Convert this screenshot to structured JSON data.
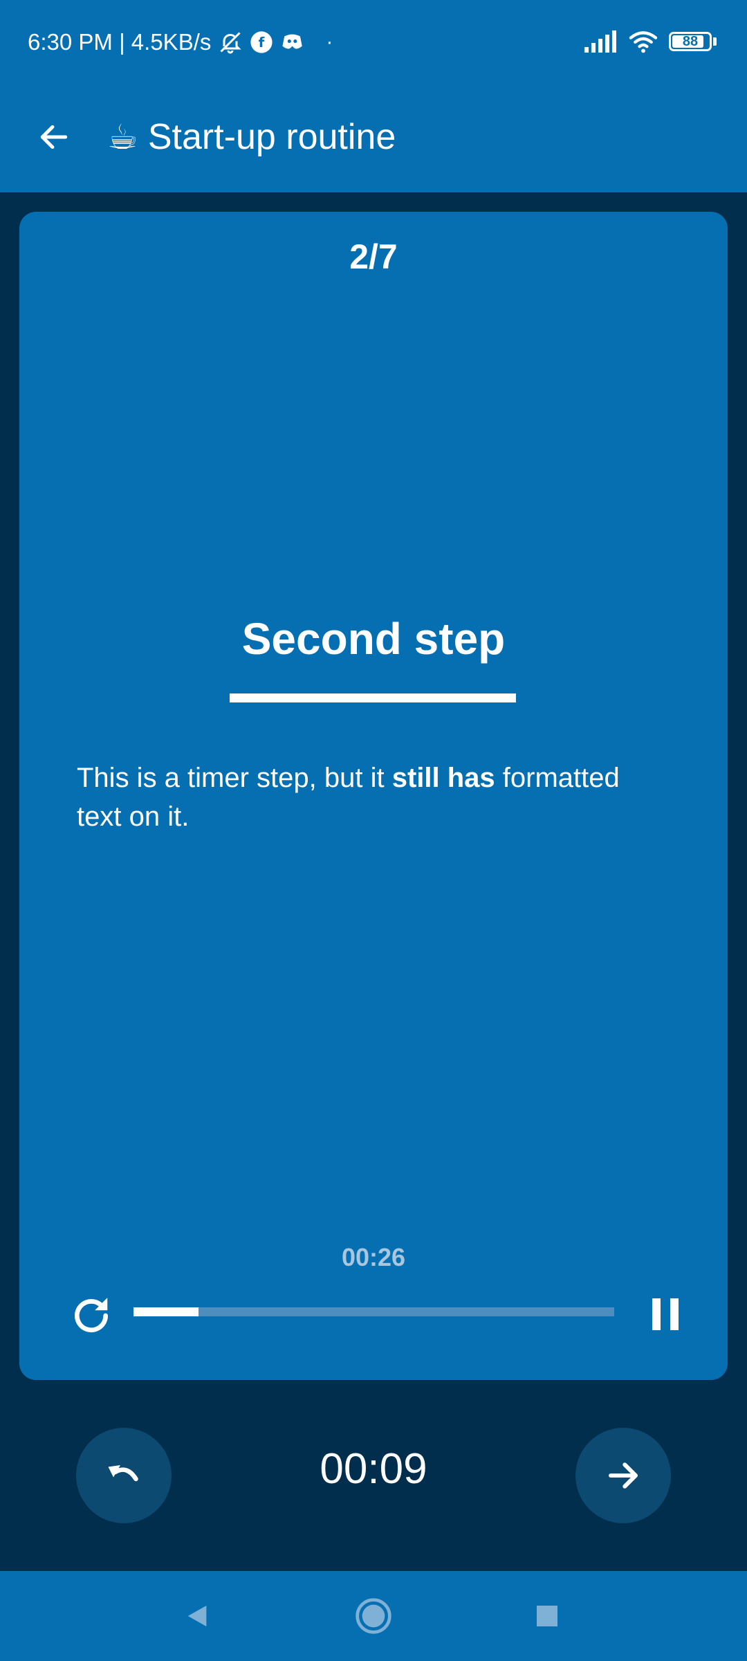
{
  "status_bar": {
    "time_speed": "6:30 PM | 4.5KB/s",
    "dot": "·",
    "battery": "88",
    "battery_level": 0.88,
    "icons": [
      "bell-off-icon",
      "app-icon",
      "discord-icon",
      "signal-icon",
      "wifi-icon",
      "battery-icon"
    ]
  },
  "app_bar": {
    "emoji": "☕",
    "title": "Start-up routine",
    "back_icon": "arrow-left-icon"
  },
  "step": {
    "counter": "2/7",
    "title": "Second step",
    "body_before": "This is a timer step, but it ",
    "body_bold": "still has",
    "body_after": " formatted text on it."
  },
  "timer": {
    "remaining": "00:26",
    "progress": 0.135,
    "restart_icon": "restart-icon",
    "pause_icon": "pause-icon"
  },
  "controls": {
    "elapsed": "00:09",
    "undo_icon": "undo-icon",
    "next_icon": "arrow-right-icon"
  },
  "nav": {
    "icons": [
      "nav-back-icon",
      "nav-home-icon",
      "nav-recents-icon"
    ]
  },
  "colors": {
    "primary": "#066fb2",
    "background": "#002e4c",
    "round_button": "#0c4a72",
    "track": "#4d8ebf",
    "muted_text": "#a8c6de"
  }
}
